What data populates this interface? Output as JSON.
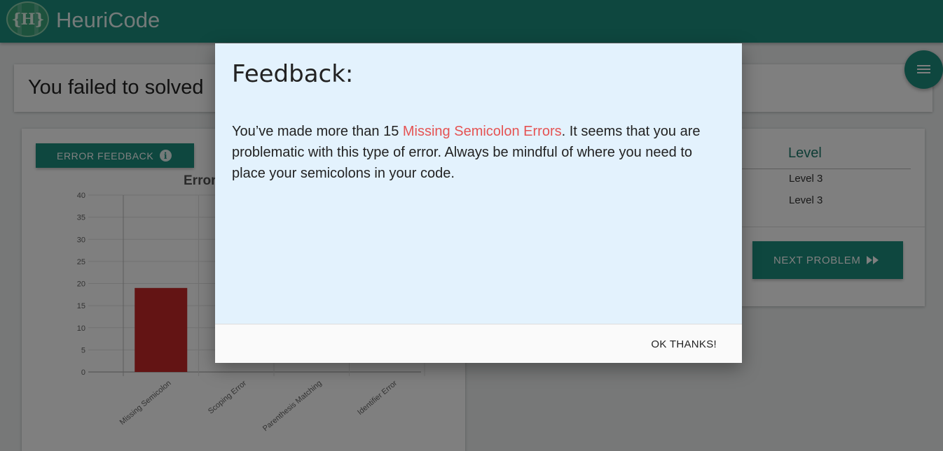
{
  "app": {
    "brand": "HeuriCode",
    "logo_text": "{H}"
  },
  "result": {
    "title": "You failed to solved"
  },
  "error_feedback_button": {
    "label": "ERROR FEEDBACK"
  },
  "chart_data": {
    "type": "bar",
    "title": "Error",
    "categories": [
      "Missing Semicolon",
      "Scoping Error",
      "Parenthesis Matching",
      "Identifier Error"
    ],
    "values": [
      19,
      0,
      0,
      0
    ],
    "ylim": [
      0,
      40
    ],
    "yticks": [
      0,
      5,
      10,
      15,
      20,
      25,
      30,
      35,
      40
    ],
    "bar_color": "#c62828",
    "grid": true
  },
  "table": {
    "header": "Level",
    "rows": [
      "Level 3",
      "Level 3"
    ]
  },
  "next_button": {
    "label": "NEXT PROBLEM"
  },
  "modal": {
    "title": "Feedback:",
    "body_before": "You’ve made more than 15 ",
    "body_highlight": "Missing Semicolon Errors",
    "body_after": ". It seems that you are problematic with this type of error. Always be mindful of where you need to place your semicolons in your code.",
    "ok_label": "OK THANKS!"
  },
  "colors": {
    "primary": "#1c8f7e",
    "highlight": "#e55353",
    "modal_bg": "#e3f2fd"
  }
}
